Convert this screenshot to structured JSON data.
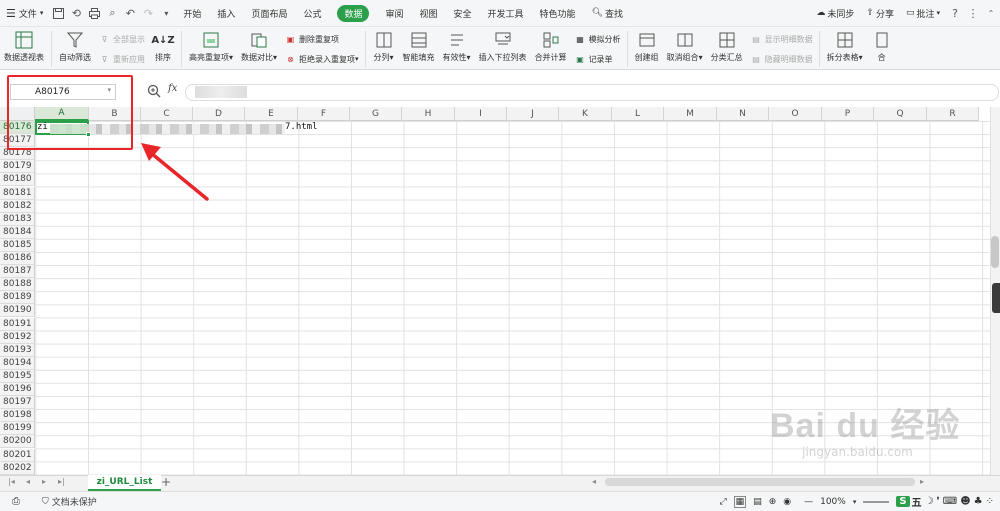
{
  "menu": {
    "file_label": "文件",
    "tabs": [
      "开始",
      "插入",
      "页面布局",
      "公式",
      "数据",
      "审阅",
      "视图",
      "安全",
      "开发工具",
      "特色功能"
    ],
    "active_tab": "数据",
    "search_label": "查找",
    "sync_label": "未同步",
    "share_label": "分享",
    "comment_label": "批注"
  },
  "ribbon": {
    "pivot": "数据透视表",
    "autofilter": "自动筛选",
    "show_all": "全部显示",
    "reapply": "重新应用",
    "sort": "排序",
    "highlight_dup": "高亮重复项",
    "data_compare": "数据对比",
    "delete_dup": "删除重复项",
    "reject_dup": "拒绝录入重复项",
    "split": "分列",
    "smart_fill": "智能填充",
    "validity": "有效性",
    "dropdown": "插入下拉列表",
    "merge_calc": "合并计算",
    "simulate": "模拟分析",
    "record": "记录单",
    "create_group": "创建组",
    "ungroup": "取消组合",
    "subtotal": "分类汇总",
    "show_detail": "显示明细数据",
    "hide_detail": "隐藏明细数据",
    "split_table": "拆分表格",
    "more": "合"
  },
  "formula_bar": {
    "name_box": "A80176",
    "fx": "fx"
  },
  "columns": [
    "A",
    "B",
    "C",
    "D",
    "E",
    "F",
    "G",
    "H",
    "I",
    "J",
    "K",
    "L",
    "M",
    "N",
    "O",
    "P",
    "Q",
    "R"
  ],
  "rows": [
    "80176",
    "80177",
    "80178",
    "80179",
    "80180",
    "80181",
    "80182",
    "80183",
    "80184",
    "80185",
    "80186",
    "80187",
    "80188",
    "80189",
    "80190",
    "80191",
    "80192",
    "80193",
    "80194",
    "80195",
    "80196",
    "80197",
    "80198",
    "80199",
    "80200",
    "80201",
    "80202"
  ],
  "cell_a": {
    "prefix": "zi",
    "suffix": "7.html"
  },
  "sheet": {
    "tab_name": "zi_URL_List",
    "add": "+"
  },
  "status": {
    "doc_protect": "文档未保护",
    "zoom": "100%",
    "ime": "五"
  },
  "watermark": {
    "brand": "Bai du 经验",
    "url": "jingyan.baidu.com"
  },
  "colors": {
    "accent": "#2c9f4b",
    "annotation": "#e8262a"
  }
}
